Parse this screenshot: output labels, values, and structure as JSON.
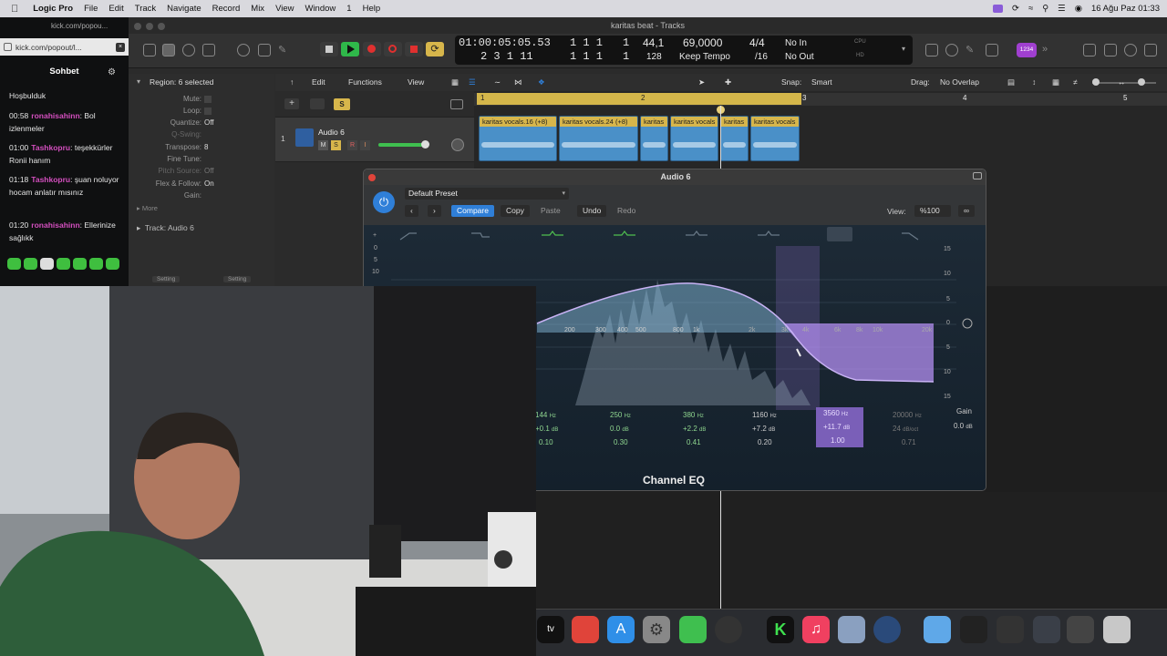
{
  "menubar": {
    "app": "Logic Pro",
    "items": [
      "File",
      "Edit",
      "Track",
      "Navigate",
      "Record",
      "Mix",
      "View",
      "Window",
      "1",
      "Help"
    ],
    "window_title": "karitas beat - Tracks",
    "clock": "16 Ağu Paz  01:33"
  },
  "chat": {
    "url": "kick.com/popout/l...",
    "url_top": "kick.com/popou...",
    "title": "Sohbet",
    "messages": [
      {
        "time": "",
        "user": "",
        "text": "Hoşbulduk"
      },
      {
        "time": "00:58",
        "user": "ronahisahinn",
        "text": "Bol izlenmeler"
      },
      {
        "time": "01:00",
        "user": "Tashkopru",
        "text": "teşekkürler Ronii hanım"
      },
      {
        "time": "01:18",
        "user": "Tashkopru",
        "text": "şuan noluyor hocam anlatır mısınız"
      },
      {
        "time": "01:20",
        "user": "ronahisahinn",
        "text": "Ellerinize sağlıkk"
      }
    ]
  },
  "transport": {
    "position": "01:00:05:05.53",
    "bars1": "1  1  1",
    "bar_a": "1",
    "bars2": "2 3 1  11",
    "bars3": "1  1  1",
    "bar_b": "1",
    "tempo": "44,1",
    "tempo_b": "128",
    "freq": "69,0000",
    "keep": "Keep Tempo",
    "sig": "4/4",
    "div": "/16",
    "in": "No In",
    "out": "No Out",
    "cpu": "CPU",
    "hd": "HD",
    "badge": "1234"
  },
  "inspector": {
    "region": "Region: 6 selected",
    "rows": [
      {
        "label": "Mute:",
        "value": ""
      },
      {
        "label": "Loop:",
        "value": ""
      },
      {
        "label": "Quantize:",
        "value": "Off"
      },
      {
        "label": "Q-Swing:",
        "value": ""
      },
      {
        "label": "Transpose:",
        "value": "8"
      },
      {
        "label": "Fine Tune:",
        "value": ""
      },
      {
        "label": "Pitch Source:",
        "value": "Off"
      },
      {
        "label": "Flex & Follow:",
        "value": "On"
      },
      {
        "label": "Gain:",
        "value": ""
      }
    ],
    "more": "More",
    "track": "Track:  Audio 6",
    "setting1": "Setting",
    "setting2": "Setting"
  },
  "editbar": {
    "edit": "Edit",
    "functions": "Functions",
    "view": "View",
    "snap_label": "Snap:",
    "snap": "Smart",
    "drag_label": "Drag:",
    "drag": "No Overlap"
  },
  "track": {
    "number": "1",
    "name": "Audio 6",
    "m": "M",
    "s": "S",
    "r": "R",
    "i": "I",
    "solo_btn": "S"
  },
  "ruler": [
    "1",
    "2",
    "3",
    "4",
    "5",
    "6"
  ],
  "regions": [
    "karitas vocals.16 (+8)",
    "karitas vocals.24 (+8)",
    "karitas",
    "karitas vocals",
    "karitas",
    "karitas vocals"
  ],
  "plugin": {
    "title": "Audio 6",
    "preset": "Default Preset",
    "compare": "Compare",
    "copy": "Copy",
    "paste": "Paste",
    "undo": "Undo",
    "redo": "Redo",
    "view_label": "View:",
    "view": "%100",
    "name": "Channel EQ",
    "freq_labels": [
      "200",
      "300",
      "400",
      "500",
      "800",
      "1k",
      "2k",
      "3k",
      "4k",
      "6k",
      "8k",
      "10k",
      "20k"
    ],
    "db_left": [
      "+",
      "0",
      "5",
      "10"
    ],
    "db_right": [
      "15",
      "10",
      "5",
      "0",
      "5",
      "10",
      "15"
    ],
    "bands": [
      {
        "freq": "144",
        "unit": "Hz",
        "gain": "+0.1",
        "gunit": "dB",
        "q": "0.10"
      },
      {
        "freq": "250",
        "unit": "Hz",
        "gain": "0.0",
        "gunit": "dB",
        "q": "0.30"
      },
      {
        "freq": "380",
        "unit": "Hz",
        "gain": "+2.2",
        "gunit": "dB",
        "q": "0.41"
      },
      {
        "freq": "1160",
        "unit": "Hz",
        "gain": "+7.2",
        "gunit": "dB",
        "q": "0.20"
      },
      {
        "freq": "3560",
        "unit": "Hz",
        "gain": "+11.7",
        "gunit": "dB",
        "q": "1.00"
      },
      {
        "freq": "20000",
        "unit": "Hz",
        "gain": "24",
        "gunit": "dB/oct",
        "q": "0.71"
      }
    ],
    "gain_label": "Gain",
    "gain_value": "0.0",
    "gain_unit": "dB"
  },
  "colors": {
    "accent": "#2f7fd8",
    "play": "#2fb84a",
    "record": "#e0302f",
    "eq_curve": "#b28ef0",
    "region": "#4a90c8",
    "region_title": "#d7b64b"
  }
}
